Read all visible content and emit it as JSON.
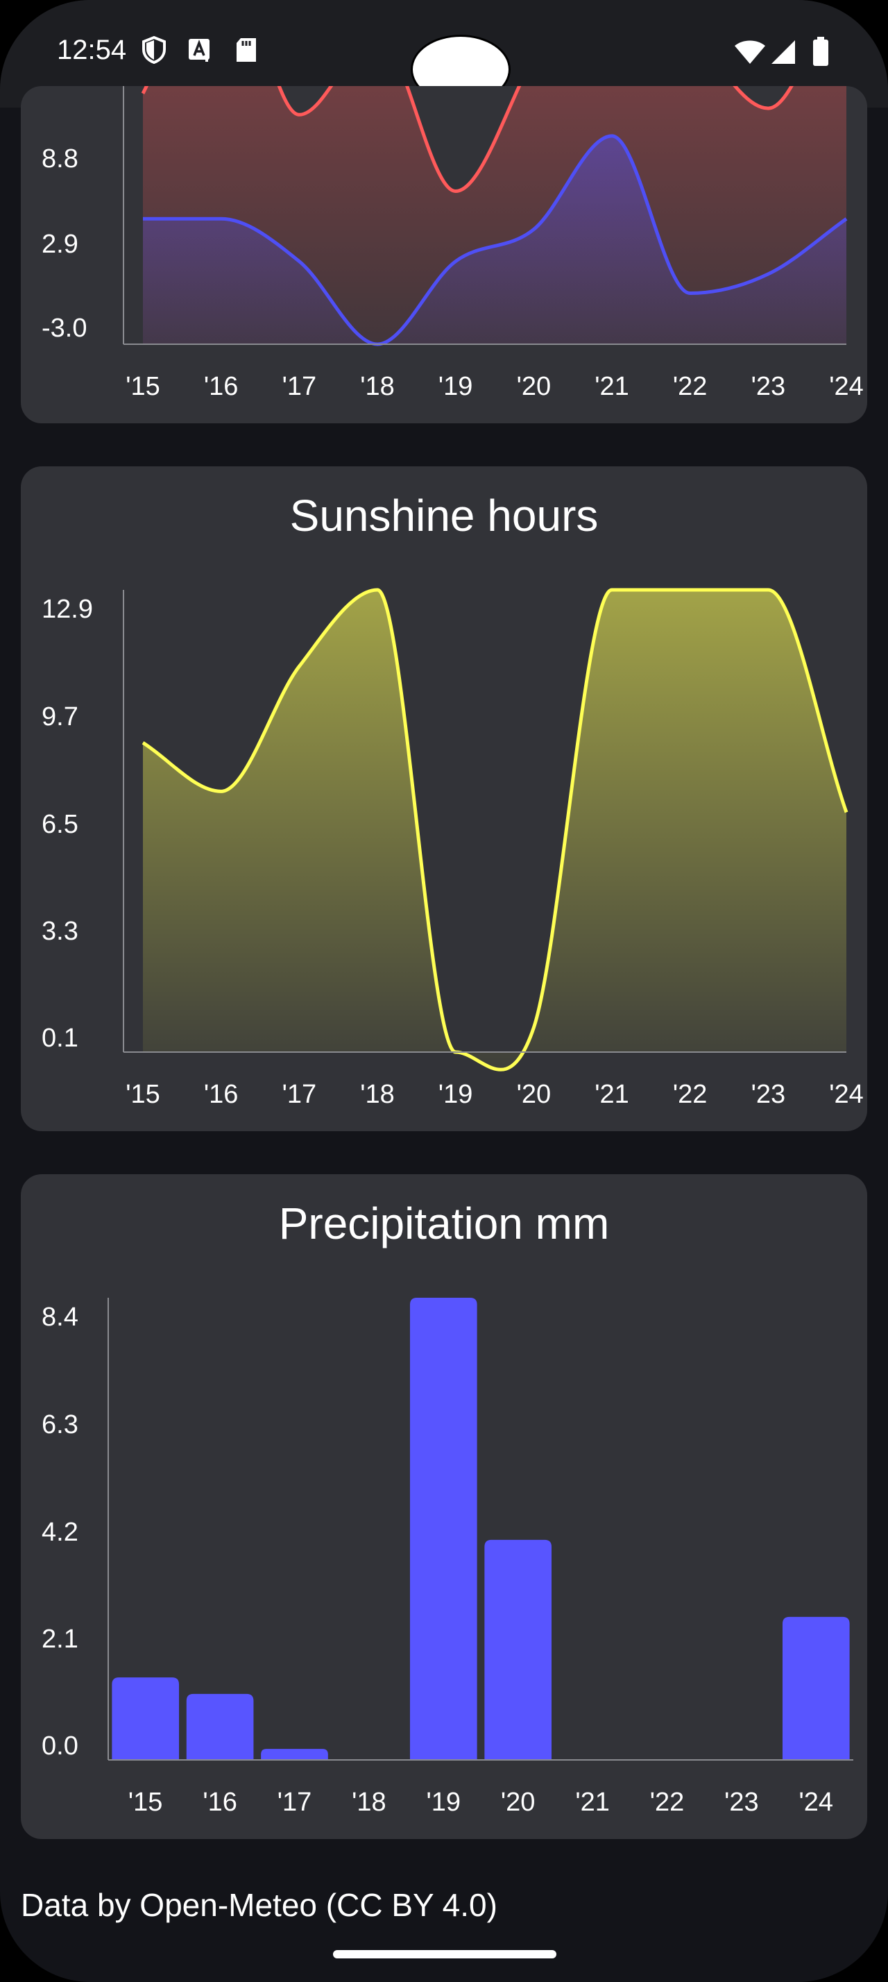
{
  "status_bar": {
    "time": "12:54",
    "left_icons": [
      "shield-icon",
      "font-icon",
      "sd-card-icon"
    ],
    "right_icons": [
      "wifi-icon",
      "signal-icon",
      "battery-icon"
    ]
  },
  "colors": {
    "background": "#131419",
    "card": "#323338",
    "max_temp_line": "#ff5a5a",
    "min_temp_line": "#4f4ff5",
    "sunshine_line": "#ffff55",
    "precip_bar": "#5855ff"
  },
  "charts": {
    "temperature": {
      "title": "",
      "x_labels": [
        "'15",
        "'16",
        "'17",
        "'18",
        "'19",
        "'20",
        "'21",
        "'22",
        "'23",
        "'24"
      ],
      "y_labels": [
        "8.8",
        "2.9",
        "-3.0"
      ]
    },
    "sunshine": {
      "title": "Sunshine hours",
      "x_labels": [
        "'15",
        "'16",
        "'17",
        "'18",
        "'19",
        "'20",
        "'21",
        "'22",
        "'23",
        "'24"
      ],
      "y_labels": [
        "12.9",
        "9.7",
        "6.5",
        "3.3",
        "0.1"
      ]
    },
    "precipitation": {
      "title": "Precipitation mm",
      "x_labels": [
        "'15",
        "'16",
        "'17",
        "'18",
        "'19",
        "'20",
        "'21",
        "'22",
        "'23",
        "'24"
      ],
      "y_labels": [
        "8.4",
        "6.3",
        "4.2",
        "2.1",
        "0.0"
      ]
    }
  },
  "chart_data": [
    {
      "type": "area",
      "title": "",
      "categories": [
        "'15",
        "'16",
        "'17",
        "'18",
        "'19",
        "'20",
        "'21",
        "'22",
        "'23",
        "'24"
      ],
      "ylim": [
        -3.0,
        14.7
      ],
      "series": [
        {
          "values": [
            8.8,
            16.0,
            7.8,
            11.5,
            4.2,
            10.5,
            17.0,
            12.0,
            8.1,
            15.0
          ]
        },
        {
          "values": [
            2.9,
            2.9,
            0.9,
            -3.0,
            0.9,
            2.4,
            6.8,
            -0.6,
            0.3,
            2.9
          ]
        }
      ]
    },
    {
      "type": "area",
      "title": "Sunshine hours",
      "categories": [
        "'15",
        "'16",
        "'17",
        "'18",
        "'19",
        "'20",
        "'21",
        "'22",
        "'23",
        "'24"
      ],
      "ylim": [
        0.1,
        13.4
      ],
      "series": [
        {
          "values": [
            9.0,
            7.6,
            11.2,
            13.4,
            0.1,
            0.8,
            13.4,
            13.4,
            13.4,
            7.0
          ]
        }
      ]
    },
    {
      "type": "bar",
      "title": "Precipitation mm",
      "categories": [
        "'15",
        "'16",
        "'17",
        "'18",
        "'19",
        "'20",
        "'21",
        "'22",
        "'23",
        "'24"
      ],
      "ylim": [
        0.0,
        8.4
      ],
      "values": [
        1.5,
        1.2,
        0.2,
        0.0,
        8.4,
        4.0,
        0.0,
        0.0,
        0.0,
        2.6
      ]
    }
  ],
  "footer": {
    "attribution": "Data by Open-Meteo (CC BY 4.0)"
  }
}
